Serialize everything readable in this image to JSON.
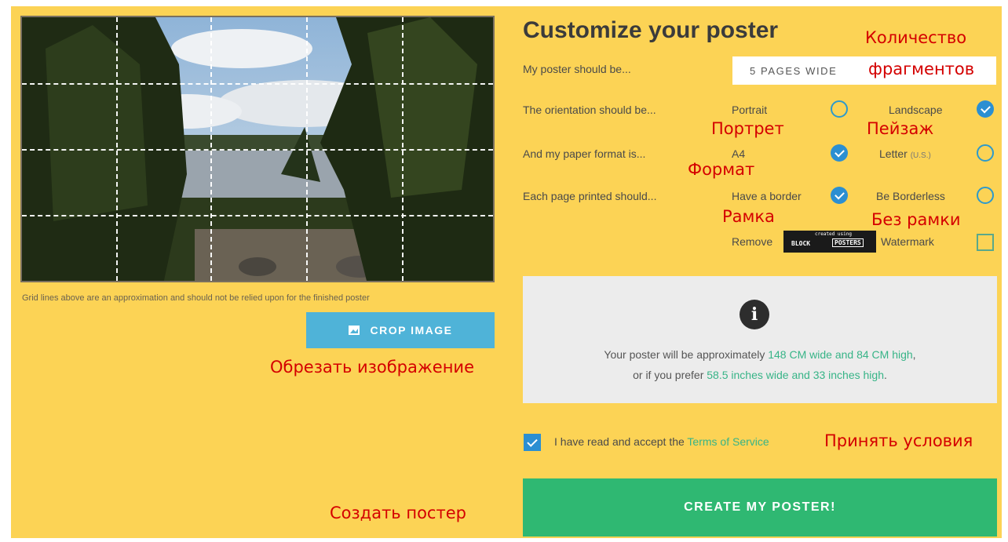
{
  "preview": {
    "grid_note": "Grid lines above are an approximation and should not be relied upon for the finished poster",
    "crop_button_label": "CROP IMAGE"
  },
  "form": {
    "title": "Customize your poster",
    "size_label": "My poster should be...",
    "size_value": "5 PAGES WIDE",
    "orientation_label": "The orientation should be...",
    "orientation_portrait": "Portrait",
    "orientation_landscape": "Landscape",
    "orientation_selected": "Landscape",
    "paper_label": "And my paper format is...",
    "paper_a4": "A4",
    "paper_letter": "Letter",
    "paper_letter_note": "(U.S.)",
    "paper_selected": "A4",
    "border_label": "Each page printed should...",
    "border_have": "Have a border",
    "border_less": "Be Borderless",
    "border_selected": "Have a border",
    "watermark_prefix": "Remove",
    "watermark_suffix": "Watermark",
    "watermark_checked": false,
    "logo_small": "created using",
    "logo_left": "BLOCK",
    "logo_right": "POSTERS"
  },
  "info": {
    "line1_prefix": "Your poster will be approximately ",
    "line1_value": "148 CM wide and 84 CM high",
    "line1_suffix": ",",
    "line2_prefix": "or if you prefer ",
    "line2_value": "58.5 inches wide and 33 inches high",
    "line2_suffix": "."
  },
  "terms": {
    "prefix": "I have read and accept the ",
    "link": "Terms of Service",
    "checked": true
  },
  "create_button_label": "CREATE MY POSTER!",
  "annotations": {
    "count": "Количество",
    "fragments": "фрагментов",
    "portrait": "Портрет",
    "landscape": "Пейзаж",
    "format": "Формат",
    "border": "Рамка",
    "borderless": "Без рамки",
    "crop": "Обрезать изображение",
    "accept": "Принять условия",
    "create": "Создать постер"
  },
  "colors": {
    "background": "#fcd355",
    "accent_blue": "#2b8fd2",
    "crop_button": "#4fb3d8",
    "create_button": "#2fb872",
    "annotation_red": "#d40000",
    "link_green": "#37b487"
  }
}
